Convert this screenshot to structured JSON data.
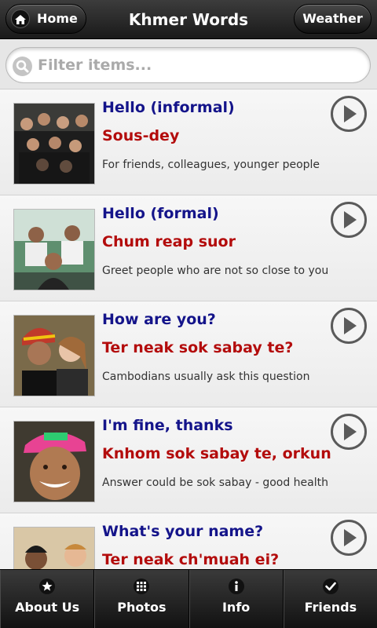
{
  "header": {
    "title": "Khmer Words",
    "home_label": "Home",
    "weather_label": "Weather"
  },
  "search": {
    "placeholder": "Filter items..."
  },
  "items": [
    {
      "english": "Hello (informal)",
      "khmer": "Sous-dey",
      "note": "For friends, colleagues, younger people"
    },
    {
      "english": "Hello (formal)",
      "khmer": "Chum reap suor",
      "note": "Greet people who are not so close to you"
    },
    {
      "english": "How are you?",
      "khmer": "Ter neak sok sabay te?",
      "note": "Cambodians usually ask this question"
    },
    {
      "english": "I'm fine, thanks",
      "khmer": "Knhom sok sabay te, orkun",
      "note": "Answer could be sok sabay - good health"
    },
    {
      "english": "What's your name?",
      "khmer": "Ter neak ch'muah ei?",
      "note": ""
    }
  ],
  "tabs": [
    {
      "label": "About Us",
      "icon": "star-icon"
    },
    {
      "label": "Photos",
      "icon": "grid-icon"
    },
    {
      "label": "Info",
      "icon": "info-icon"
    },
    {
      "label": "Friends",
      "icon": "check-icon"
    }
  ],
  "colors": {
    "english": "#14148a",
    "khmer": "#b30c0c",
    "bar": "#1a1a1a"
  }
}
